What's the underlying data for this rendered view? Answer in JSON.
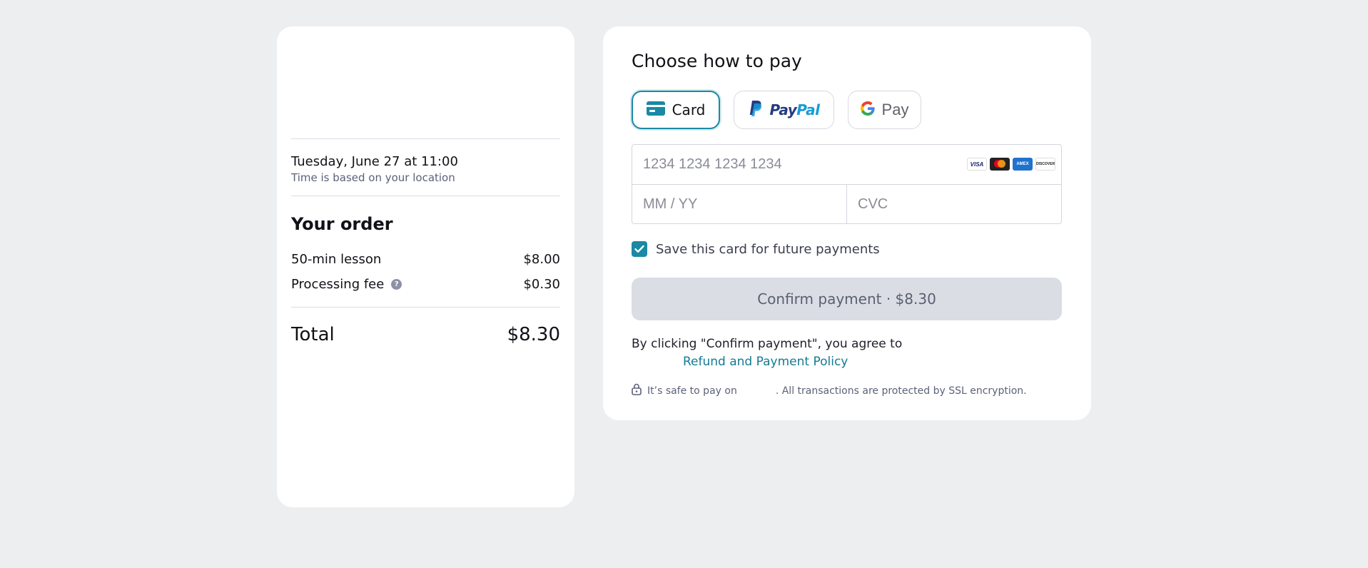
{
  "order": {
    "lesson_date": "Tuesday, June 27 at 11:00",
    "date_note": "Time is based on your location",
    "title": "Your order",
    "items": [
      {
        "label": "50-min lesson",
        "price": "$8.00"
      },
      {
        "label": "Processing fee",
        "price": "$0.30",
        "has_help_icon": true
      }
    ],
    "total_label": "Total",
    "total_value": "$8.30"
  },
  "payment": {
    "title": "Choose how to pay",
    "methods": [
      {
        "label": "Card",
        "icon": "credit-card-icon",
        "selected": true
      },
      {
        "label": "PayPal",
        "icon": "paypal-logo",
        "selected": false
      },
      {
        "label": "Pay",
        "icon": "google-g-logo",
        "selected": false
      }
    ],
    "paypal_part1": "Pay",
    "paypal_part2": "Pal",
    "card_number_placeholder": "1234 1234 1234 1234",
    "expiry_placeholder": "MM / YY",
    "cvc_placeholder": "CVC",
    "card_brands": [
      "VISA",
      "Mastercard",
      "AMEX",
      "DISCOVER"
    ],
    "save_card_label": "Save this card for future payments",
    "save_card_checked": true,
    "confirm_label": "Confirm payment · $8.30",
    "agree_text": "By clicking \"Confirm payment\", you agree to",
    "policy_link": "Refund and Payment Policy",
    "safe_text_before": "It’s safe to pay on",
    "safe_text_after": ". All transactions are protected by SSL encryption."
  },
  "colors": {
    "accent": "#1989a4",
    "background": "#edeef0",
    "confirm_disabled": "#dadde4"
  }
}
